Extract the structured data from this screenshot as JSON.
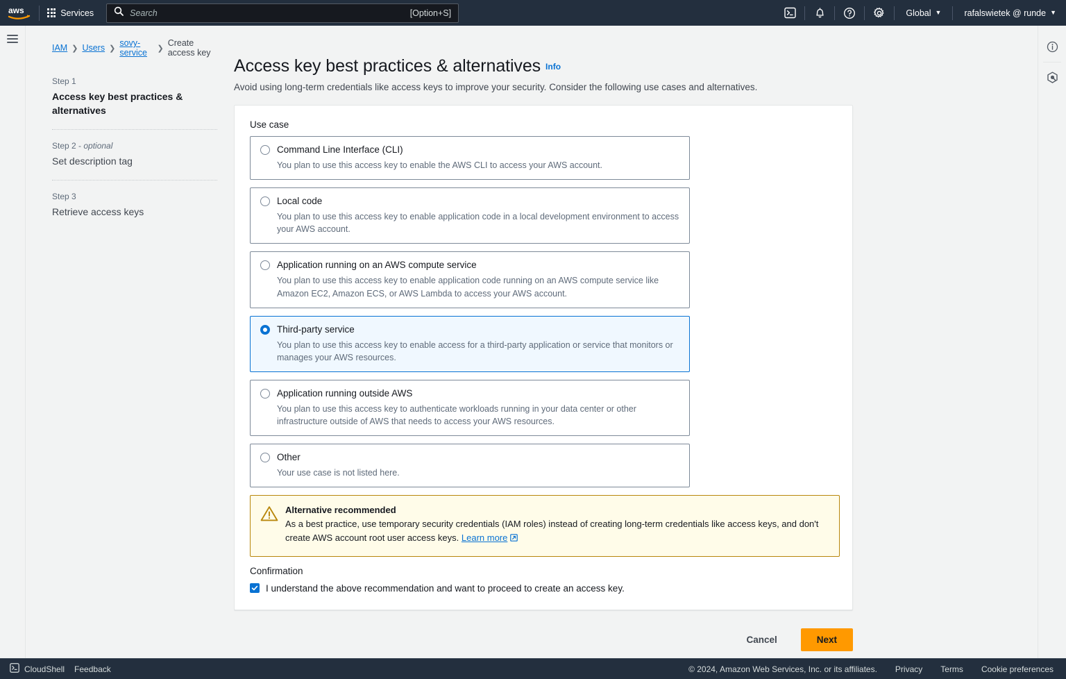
{
  "topnav": {
    "logo_alt": "aws",
    "services_label": "Services",
    "search_placeholder": "Search",
    "search_value": "",
    "search_shortcut": "[Option+S]",
    "cloudshell_icon": "cloudshell-icon",
    "bell_icon": "notifications-icon",
    "help_icon": "help-icon",
    "settings_icon": "settings-icon",
    "region_label": "Global",
    "account_label": "rafalswietek @ runde"
  },
  "breadcrumb": [
    {
      "label": "IAM",
      "link": true
    },
    {
      "label": "Users",
      "link": true
    },
    {
      "label": "sovy-service",
      "link": true
    },
    {
      "label": "Create access key",
      "link": false
    }
  ],
  "steps": [
    {
      "step": "Step 1",
      "optional": "",
      "title": "Access key best practices & alternatives",
      "active": true
    },
    {
      "step": "Step 2 - ",
      "optional": "optional",
      "title": "Set description tag",
      "active": false
    },
    {
      "step": "Step 3",
      "optional": "",
      "title": "Retrieve access keys",
      "active": false
    }
  ],
  "header": {
    "title": "Access key best practices & alternatives",
    "info_label": "Info",
    "subtitle": "Avoid using long-term credentials like access keys to improve your security. Consider the following use cases and alternatives."
  },
  "form": {
    "use_case_label": "Use case",
    "options": [
      {
        "title": "Command Line Interface (CLI)",
        "desc": "You plan to use this access key to enable the AWS CLI to access your AWS account.",
        "selected": false
      },
      {
        "title": "Local code",
        "desc": "You plan to use this access key to enable application code in a local development environment to access your AWS account.",
        "selected": false
      },
      {
        "title": "Application running on an AWS compute service",
        "desc": "You plan to use this access key to enable application code running on an AWS compute service like Amazon EC2, Amazon ECS, or AWS Lambda to access your AWS account.",
        "selected": false
      },
      {
        "title": "Third-party service",
        "desc": "You plan to use this access key to enable access for a third-party application or service that monitors or manages your AWS resources.",
        "selected": true
      },
      {
        "title": "Application running outside AWS",
        "desc": "You plan to use this access key to authenticate workloads running in your data center or other infrastructure outside of AWS that needs to access your AWS resources.",
        "selected": false
      },
      {
        "title": "Other",
        "desc": "Your use case is not listed here.",
        "selected": false
      }
    ],
    "alert": {
      "icon": "warning-triangle-icon",
      "title": "Alternative recommended",
      "text": "As a best practice, use temporary security credentials (IAM roles) instead of creating long-term credentials like access keys, and don't create AWS account root user access keys.",
      "link_label": "Learn more"
    },
    "confirmation_label": "Confirmation",
    "confirmation_text": "I understand the above recommendation and want to proceed to create an access key.",
    "confirmation_checked": true
  },
  "actions": {
    "cancel_label": "Cancel",
    "next_label": "Next"
  },
  "rightrail": {
    "info_icon": "info-circle-icon",
    "security_icon": "shield-hexagon-icon"
  },
  "footer": {
    "cloudshell_label": "CloudShell",
    "feedback_label": "Feedback",
    "copyright": "© 2024, Amazon Web Services, Inc. or its affiliates.",
    "privacy_label": "Privacy",
    "terms_label": "Terms",
    "cookie_label": "Cookie preferences"
  },
  "colors": {
    "nav_bg": "#232f3e",
    "accent_link": "#0972d3",
    "primary_button": "#ff9900",
    "alert_bg": "#fffce9",
    "alert_border": "#b8860b",
    "selected_bg": "#f0f8ff"
  }
}
